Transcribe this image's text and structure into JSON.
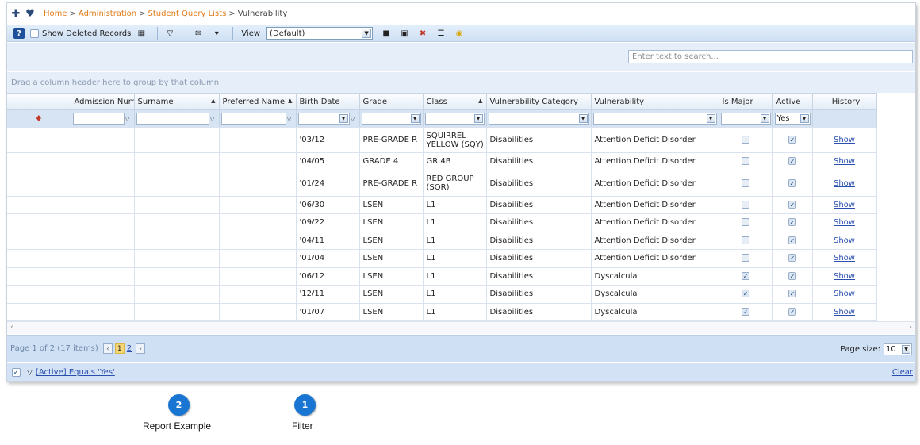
{
  "breadcrumb": {
    "home": "Home",
    "sep": ">",
    "admin": "Administration",
    "lists": "Student Query Lists",
    "current": "Vulnerability"
  },
  "toolbar": {
    "show_deleted": "Show Deleted Records",
    "view_label": "View",
    "view_value": "(Default)"
  },
  "search": {
    "placeholder": "Enter text to search..."
  },
  "group_hint": "Drag a column header here to group by that column",
  "columns": [
    "",
    "Admission Numb",
    "Surname",
    "Preferred Name",
    "Birth Date",
    "Grade",
    "Class",
    "Vulnerability Category",
    "Vulnerability",
    "Is Major",
    "Active",
    "History"
  ],
  "filter_active_value": "Yes",
  "rows": [
    {
      "birth": "'03/12",
      "grade": "PRE-GRADE R",
      "class": "SQUIRREL YELLOW (SQY)",
      "category": "Disabilities",
      "vuln": "Attention Deficit Disorder",
      "major": false,
      "active": true,
      "history": "Show"
    },
    {
      "birth": "'04/05",
      "grade": "GRADE 4",
      "class": "GR 4B",
      "category": "Disabilities",
      "vuln": "Attention Deficit Disorder",
      "major": false,
      "active": true,
      "history": "Show"
    },
    {
      "birth": "'01/24",
      "grade": "PRE-GRADE R",
      "class": "RED GROUP (SQR)",
      "category": "Disabilities",
      "vuln": "Attention Deficit Disorder",
      "major": false,
      "active": true,
      "history": "Show"
    },
    {
      "birth": "'06/30",
      "grade": "LSEN",
      "class": "L1",
      "category": "Disabilities",
      "vuln": "Attention Deficit Disorder",
      "major": false,
      "active": true,
      "history": "Show"
    },
    {
      "birth": "'09/22",
      "grade": "LSEN",
      "class": "L1",
      "category": "Disabilities",
      "vuln": "Attention Deficit Disorder",
      "major": false,
      "active": true,
      "history": "Show"
    },
    {
      "birth": "'04/11",
      "grade": "LSEN",
      "class": "L1",
      "category": "Disabilities",
      "vuln": "Attention Deficit Disorder",
      "major": false,
      "active": true,
      "history": "Show"
    },
    {
      "birth": "'01/04",
      "grade": "LSEN",
      "class": "L1",
      "category": "Disabilities",
      "vuln": "Attention Deficit Disorder",
      "major": false,
      "active": true,
      "history": "Show"
    },
    {
      "birth": "'06/12",
      "grade": "LSEN",
      "class": "L1",
      "category": "Disabilities",
      "vuln": "Dyscalcula",
      "major": true,
      "active": true,
      "history": "Show"
    },
    {
      "birth": "'12/11",
      "grade": "LSEN",
      "class": "L1",
      "category": "Disabilities",
      "vuln": "Dyscalcula",
      "major": true,
      "active": true,
      "history": "Show"
    },
    {
      "birth": "'01/07",
      "grade": "LSEN",
      "class": "L1",
      "category": "Disabilities",
      "vuln": "Dyscalcula",
      "major": true,
      "active": true,
      "history": "Show"
    }
  ],
  "pager": {
    "info": "Page 1 of 2 (17 items)",
    "current": "1",
    "page2": "2",
    "size_label": "Page size:",
    "size_value": "10"
  },
  "filter_bar": {
    "expression": "[Active] Equals 'Yes'",
    "clear": "Clear"
  },
  "callouts": [
    {
      "number": "2",
      "label": "Report Example"
    },
    {
      "number": "1",
      "label": "Filter"
    }
  ],
  "colors": {
    "accent": "#1975d2",
    "breadcrumb_link": "#e07b16",
    "link": "#2b4fb0"
  }
}
